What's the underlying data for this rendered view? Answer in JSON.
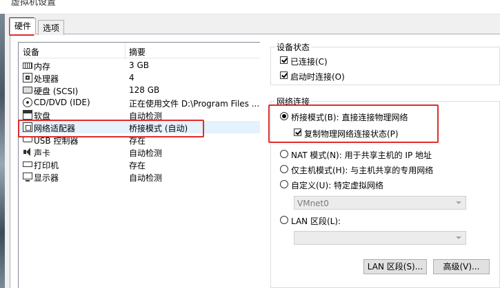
{
  "window": {
    "title": "虚拟机设置"
  },
  "tabs": [
    {
      "label": "硬件"
    },
    {
      "label": "选项"
    }
  ],
  "device_list": {
    "headers": {
      "device": "设备",
      "summary": "摘要"
    },
    "rows": [
      {
        "name": "内存",
        "summary": "3 GB",
        "icon": "memory-icon"
      },
      {
        "name": "处理器",
        "summary": "4",
        "icon": "processor-icon"
      },
      {
        "name": "硬盘 (SCSI)",
        "summary": "128 GB",
        "icon": "hard-disk-icon"
      },
      {
        "name": "CD/DVD (IDE)",
        "summary": "正在使用文件 D:\\Program Files ...",
        "icon": "cd-dvd-icon"
      },
      {
        "name": "软盘",
        "summary": "自动检测",
        "icon": "floppy-icon"
      },
      {
        "name": "网络适配器",
        "summary": "桥接模式 (自动)",
        "icon": "network-adapter-icon"
      },
      {
        "name": "USB 控制器",
        "summary": "存在",
        "icon": "usb-icon"
      },
      {
        "name": "声卡",
        "summary": "自动检测",
        "icon": "sound-icon"
      },
      {
        "name": "打印机",
        "summary": "存在",
        "icon": "printer-icon"
      },
      {
        "name": "显示器",
        "summary": "自动检测",
        "icon": "display-icon"
      }
    ]
  },
  "device_status": {
    "title": "设备状态",
    "connected": "已连接(C)",
    "connect_at_power_on": "启动时连接(O)"
  },
  "network": {
    "title": "网络连接",
    "bridged": "桥接模式(B): 直接连接物理网络",
    "replicate": "复制物理网络连接状态(P)",
    "nat": "NAT 模式(N): 用于共享主机的 IP 地址",
    "host_only": "仅主机模式(H): 与主机共享的专用网络",
    "custom": "自定义(U): 特定虚拟网络",
    "custom_value": "VMnet0",
    "lan_segment": "LAN 区段(L):",
    "lan_segment_value": ""
  },
  "buttons": {
    "lan_segments": "LAN 区段(S)...",
    "advanced": "高级(V)..."
  },
  "colors": {
    "highlight": "#e02b2b",
    "selection": "#e5f1fb"
  }
}
